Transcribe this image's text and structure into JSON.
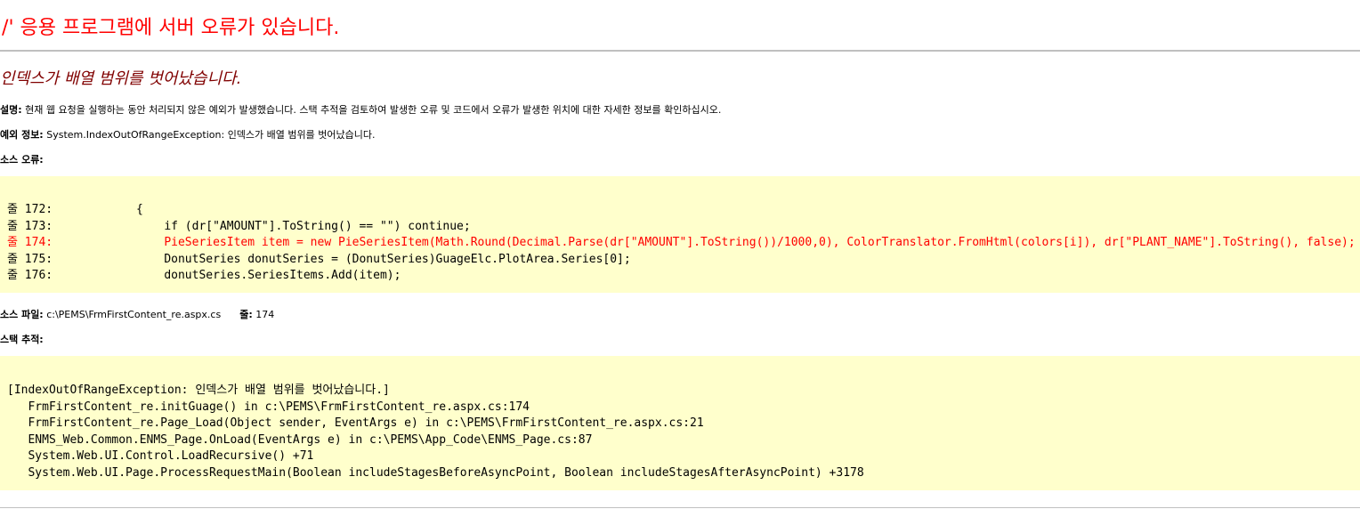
{
  "header": {
    "title": "'/' 응용 프로그램에 서버 오류가 있습니다.",
    "error_message": "인덱스가 배열 범위를 벗어났습니다."
  },
  "description": {
    "label": "설명:",
    "text": "현재 웹 요청을 실행하는 동안 처리되지 않은 예외가 발생했습니다. 스택 추적을 검토하여 발생한 오류 및 코드에서 오류가 발생한 위치에 대한 자세한 정보를 확인하십시오."
  },
  "exception_info": {
    "label": "예외 정보:",
    "text": "System.IndexOutOfRangeException: 인덱스가 배열 범위를 벗어났습니다."
  },
  "source_error": {
    "label": "소스 오류:",
    "lines": [
      {
        "text": "줄 172:            {",
        "highlight": false
      },
      {
        "text": "줄 173:                if (dr[\"AMOUNT\"].ToString() == \"\") continue;",
        "highlight": false
      },
      {
        "text": "줄 174:                PieSeriesItem item = new PieSeriesItem(Math.Round(Decimal.Parse(dr[\"AMOUNT\"].ToString())/1000,0), ColorTranslator.FromHtml(colors[i]), dr[\"PLANT_NAME\"].ToString(), false);",
        "highlight": true
      },
      {
        "text": "줄 175:                DonutSeries donutSeries = (DonutSeries)GuageElc.PlotArea.Series[0];",
        "highlight": false
      },
      {
        "text": "줄 176:                donutSeries.SeriesItems.Add(item);",
        "highlight": false
      }
    ]
  },
  "source_file": {
    "label": "소스 파일:",
    "path": "c:\\PEMS\\FrmFirstContent_re.aspx.cs",
    "line_label": "줄:",
    "line_number": "174"
  },
  "stack_trace": {
    "label": "스택 추적:",
    "lines": [
      "[IndexOutOfRangeException: 인덱스가 배열 범위를 벗어났습니다.]",
      "   FrmFirstContent_re.initGuage() in c:\\PEMS\\FrmFirstContent_re.aspx.cs:174",
      "   FrmFirstContent_re.Page_Load(Object sender, EventArgs e) in c:\\PEMS\\FrmFirstContent_re.aspx.cs:21",
      "   ENMS_Web.Common.ENMS_Page.OnLoad(EventArgs e) in c:\\PEMS\\App_Code\\ENMS_Page.cs:87",
      "   System.Web.UI.Control.LoadRecursive() +71",
      "   System.Web.UI.Page.ProcessRequestMain(Boolean includeStagesBeforeAsyncPoint, Boolean includeStagesAfterAsyncPoint) +3178"
    ]
  },
  "colors": {
    "title": "#ff0000",
    "error_heading": "#800000",
    "highlight_line": "#ff0000",
    "code_background": "#ffffcc",
    "rule": "#c0c0c0"
  }
}
